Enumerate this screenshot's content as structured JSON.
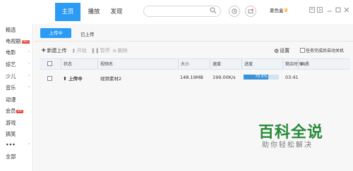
{
  "nav": {
    "home": "主页",
    "play": "播放",
    "discover": "发现"
  },
  "user": {
    "name": "夏色盒"
  },
  "sidebar": {
    "items": [
      {
        "label": "精选"
      },
      {
        "label": "电视剧",
        "badge": "HOT"
      },
      {
        "label": "电影"
      },
      {
        "label": "综艺"
      },
      {
        "label": "少儿"
      },
      {
        "label": "音乐"
      },
      {
        "label": "动漫"
      },
      {
        "label": "会员",
        "badge": "VIP"
      },
      {
        "label": "游戏"
      },
      {
        "label": "搞笑"
      },
      {
        "label": "•••"
      },
      {
        "label": "全部"
      }
    ]
  },
  "subtabs": {
    "uploading": "上传中",
    "uploaded": "已上传"
  },
  "toolbar": {
    "new_upload": "新建上传",
    "start": "开始",
    "pause": "暂停",
    "delete": "删除",
    "settings": "设置",
    "shutdown_option": "任务完成后自动关机"
  },
  "table": {
    "headers": [
      "状态",
      "视频名",
      "大小",
      "速度",
      "进度",
      "剩余时间",
      "画质"
    ],
    "rows": [
      {
        "status": "上传中",
        "name": "视频素材2",
        "size": "148.19MB",
        "speed": "199.00K/s",
        "progress_text": "70.6%",
        "progress": 0.706,
        "remaining": "03:41",
        "quality": ""
      }
    ]
  },
  "watermark": {
    "title": "百科全说",
    "subtitle": "助你轻松解决"
  },
  "colors": {
    "accent": "#2b9bf4",
    "progress": "#3a93d6",
    "watermark": "#2a8a3a"
  }
}
